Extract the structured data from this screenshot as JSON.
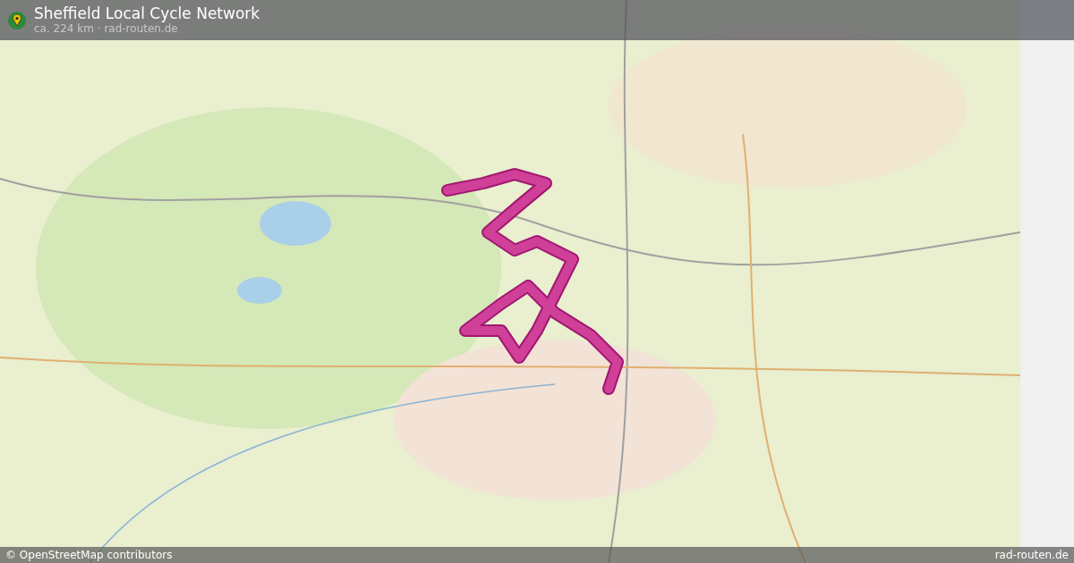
{
  "header": {
    "title": "Sheffield Local Cycle Network",
    "subtitle": "ca. 224 km · rad-routen.de"
  },
  "footer": {
    "attribution": "© OpenStreetMap contributors",
    "site": "rad-routen.de"
  }
}
